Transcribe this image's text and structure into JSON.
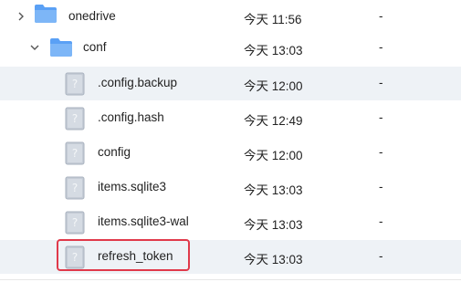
{
  "rows": [
    {
      "name": "onedrive",
      "date": "今天 11:56",
      "size": "-",
      "type": "folder-icon",
      "expanded": false
    },
    {
      "name": "conf",
      "date": "今天 13:03",
      "size": "-",
      "type": "folder-icon",
      "expanded": true
    },
    {
      "name": ".config.backup",
      "date": "今天 12:00",
      "size": "-",
      "type": "unknown-file-icon"
    },
    {
      "name": ".config.hash",
      "date": "今天 12:49",
      "size": "-",
      "type": "unknown-file-icon"
    },
    {
      "name": "config",
      "date": "今天 12:00",
      "size": "-",
      "type": "unknown-file-icon"
    },
    {
      "name": "items.sqlite3",
      "date": "今天 13:03",
      "size": "-",
      "type": "unknown-file-icon"
    },
    {
      "name": "items.sqlite3-wal",
      "date": "今天 13:03",
      "size": "-",
      "type": "unknown-file-icon"
    },
    {
      "name": "refresh_token",
      "date": "今天 13:03",
      "size": "-",
      "type": "unknown-file-icon"
    }
  ],
  "icons": {
    "unknown_file_glyph": "?"
  },
  "colors": {
    "folder": "#5aa0f5",
    "folder_tab": "#7db6f7",
    "highlight_border": "#e0394a",
    "row_alt": "#eef2f6"
  }
}
